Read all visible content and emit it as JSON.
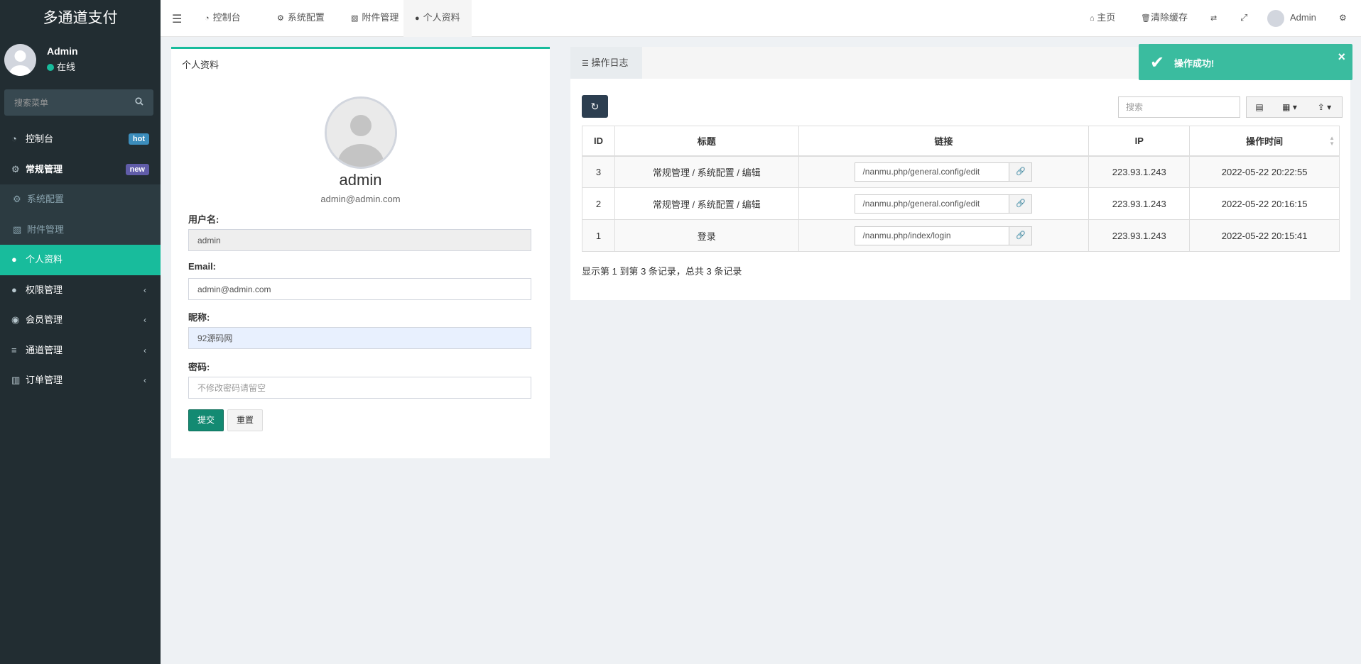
{
  "sidebar": {
    "brand": "多通道支付",
    "user": {
      "name": "Admin",
      "status": "在线"
    },
    "search_placeholder": "搜索菜单",
    "items": [
      {
        "icon": "dashboard-icon",
        "label": "控制台",
        "badge": "hot"
      },
      {
        "icon": "cogs-icon",
        "label": "常规管理",
        "badge": "new"
      },
      {
        "icon": "gear-icon",
        "label": "系统配置"
      },
      {
        "icon": "file-image-icon",
        "label": "附件管理"
      },
      {
        "icon": "user-icon",
        "label": "个人资料"
      },
      {
        "icon": "users-icon",
        "label": "权限管理"
      },
      {
        "icon": "user-circle-icon",
        "label": "会员管理"
      },
      {
        "icon": "list-icon",
        "label": "通道管理"
      },
      {
        "icon": "bar-chart-icon",
        "label": "订单管理"
      }
    ]
  },
  "topnav": {
    "tabs": [
      {
        "icon": "dashboard-icon",
        "label": "控制台"
      },
      {
        "icon": "gear-icon",
        "label": "系统配置"
      },
      {
        "icon": "file-image-icon",
        "label": "附件管理"
      },
      {
        "icon": "user-icon",
        "label": "个人资料"
      }
    ],
    "home": "主页",
    "clear_cache": "清除缓存",
    "user": "Admin"
  },
  "profile": {
    "panel_title": "个人资料",
    "name": "admin",
    "email": "admin@admin.com",
    "username_label": "用户名:",
    "username_value": "admin",
    "email_label": "Email:",
    "email_value": "admin@admin.com",
    "nickname_label": "昵称:",
    "nickname_value": "92源码网",
    "password_label": "密码:",
    "password_placeholder": "不修改密码请留空",
    "submit": "提交",
    "reset": "重置"
  },
  "log": {
    "tab": "操作日志",
    "search_placeholder": "搜索",
    "columns": [
      "ID",
      "标题",
      "链接",
      "IP",
      "操作时间"
    ],
    "rows": [
      {
        "id": "3",
        "title": "常规管理 / 系统配置 / 编辑",
        "url": "/nanmu.php/general.config/edit",
        "ip": "223.93.1.243",
        "time": "2022-05-22 20:22:55"
      },
      {
        "id": "2",
        "title": "常规管理 / 系统配置 / 编辑",
        "url": "/nanmu.php/general.config/edit",
        "ip": "223.93.1.243",
        "time": "2022-05-22 20:16:15"
      },
      {
        "id": "1",
        "title": "登录",
        "url": "/nanmu.php/index/login",
        "ip": "223.93.1.243",
        "time": "2022-05-22 20:15:41"
      }
    ],
    "pager_info": "显示第 1 到第 3 条记录，总共 3 条记录"
  },
  "toast": {
    "message": "操作成功!"
  }
}
